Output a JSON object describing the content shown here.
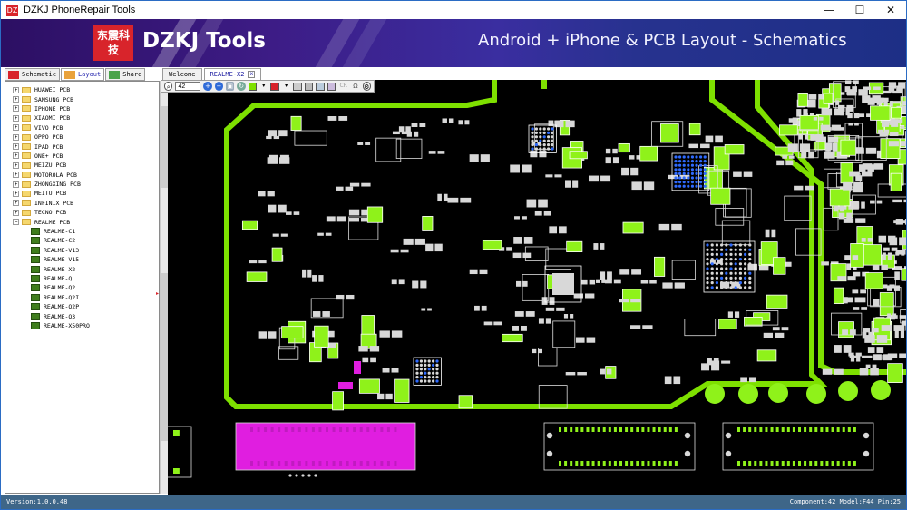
{
  "window": {
    "title": "DZKJ PhoneRepair Tools",
    "app_icon_label": "DZ",
    "minimize": "—",
    "maximize": "☐",
    "close": "✕"
  },
  "banner": {
    "logo_text": "东震科技",
    "brand": "DZKJ Tools",
    "tagline": "Android + iPhone & PCB Layout - Schematics",
    "colors": {
      "start": "#2c0f63",
      "end": "#1d2f86"
    }
  },
  "left_tabs": [
    {
      "label": "Schematic",
      "icon": "pdf-icon"
    },
    {
      "label": "Layout",
      "icon": "pads-icon"
    },
    {
      "label": "Share",
      "icon": "share-icon"
    }
  ],
  "tree": {
    "folders": [
      {
        "label": "HUAWEI PCB",
        "expander": "+"
      },
      {
        "label": "SAMSUNG PCB",
        "expander": "+"
      },
      {
        "label": "IPHONE PCB",
        "expander": "+"
      },
      {
        "label": "XIAOMI PCB",
        "expander": "+"
      },
      {
        "label": "VIVO PCB",
        "expander": "+"
      },
      {
        "label": "OPPO PCB",
        "expander": "+"
      },
      {
        "label": "IPAD PCB",
        "expander": "+"
      },
      {
        "label": "ONE+ PCB",
        "expander": "+"
      },
      {
        "label": "MEIZU PCB",
        "expander": "+"
      },
      {
        "label": "MOTOROLA PCB",
        "expander": "+"
      },
      {
        "label": "ZHONGXING PCB",
        "expander": "+"
      },
      {
        "label": "MEITU PCB",
        "expander": "+"
      },
      {
        "label": "INFINIX PCB",
        "expander": "+"
      },
      {
        "label": "TECNO PCB",
        "expander": "+"
      },
      {
        "label": "REALME PCB",
        "expander": "−"
      }
    ],
    "realme_children": [
      "REALME-C1",
      "REALME-C2",
      "REALME-V13",
      "REALME-V15",
      "REALME-X2",
      "REALME-Q",
      "REALME-Q2",
      "REALME-Q2I",
      "REALME-Q2P",
      "REALME-Q3",
      "REALME-X50PRO"
    ]
  },
  "doc_tabs": [
    {
      "label": "Welcome"
    },
    {
      "label": "REALME-X2",
      "close": "x"
    }
  ],
  "toolbar": {
    "zoom_value": "42",
    "ctrl_label": "CR"
  },
  "pcb_colors": {
    "board": "#000000",
    "trace": "#7ee000",
    "pad": "#8ff21a",
    "highlight": "#e01ee0",
    "blue": "#2f6bff",
    "pin": "#d8d8d8"
  },
  "status": {
    "version": "Version:1.0.0.48",
    "info": "Component:42 Model:F44 Pin:25"
  }
}
